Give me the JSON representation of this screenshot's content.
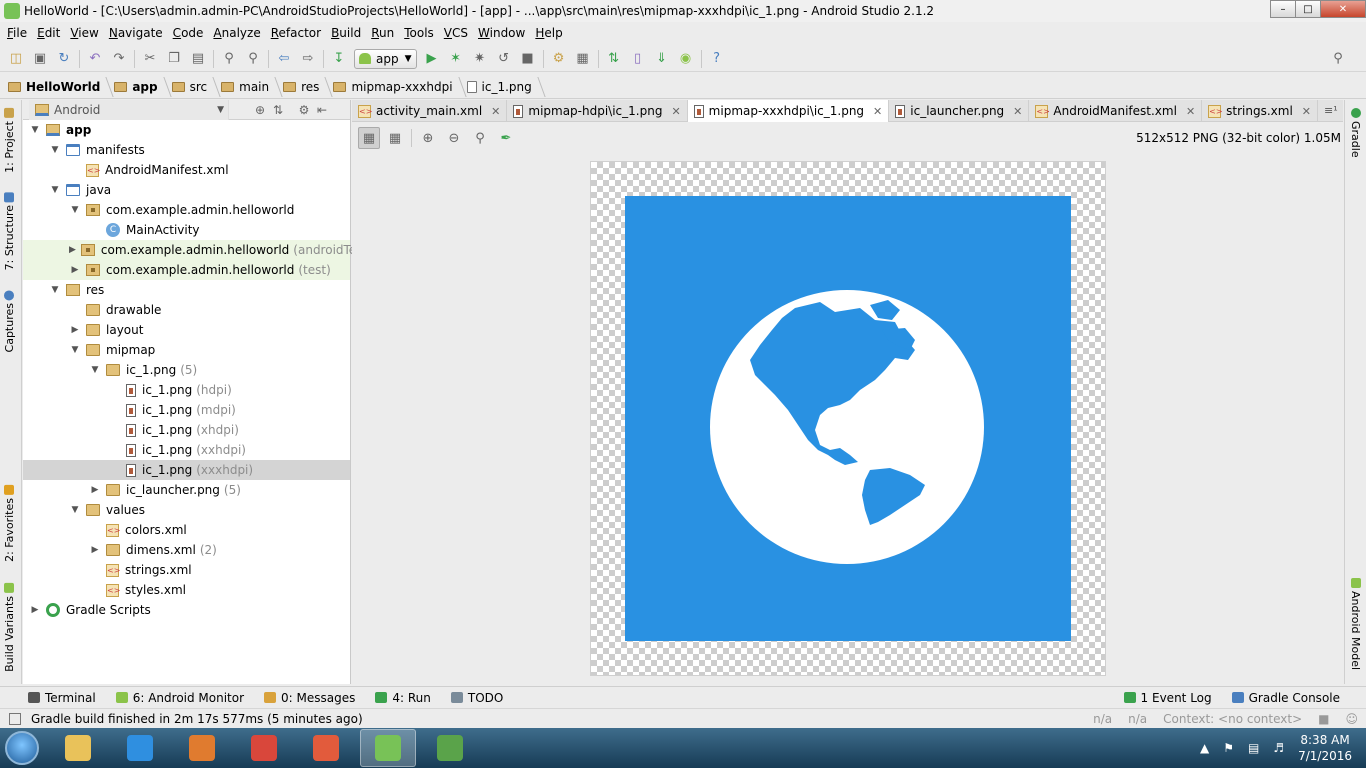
{
  "window": {
    "title": "HelloWorld - [C:\\Users\\admin.admin-PC\\AndroidStudioProjects\\HelloWorld] - [app] - ...\\app\\src\\main\\res\\mipmap-xxxhdpi\\ic_1.png - Android Studio 2.1.2",
    "minimize": "–",
    "maximize": "□",
    "close": "✕"
  },
  "menu": [
    "File",
    "Edit",
    "View",
    "Navigate",
    "Code",
    "Analyze",
    "Refactor",
    "Build",
    "Run",
    "Tools",
    "VCS",
    "Window",
    "Help"
  ],
  "toolbar": {
    "run_config": "app",
    "icons": [
      "open-icon",
      "save-icon",
      "sync-icon",
      "undo-icon",
      "redo-icon",
      "cut-icon",
      "copy-icon",
      "paste-icon",
      "find-icon",
      "replace-icon",
      "back-icon",
      "forward-icon",
      "make-icon",
      "run-icon",
      "debug-icon",
      "attach-icon",
      "apply-changes-icon",
      "stop-icon",
      "project-structure-icon",
      "sdk-manager-icon",
      "avd-manager-icon",
      "sync-gradle-icon",
      "device-monitor-icon",
      "android-icon",
      "help-icon"
    ],
    "search_icon": "search-icon"
  },
  "breadcrumb": [
    "HelloWorld",
    "app",
    "src",
    "main",
    "res",
    "mipmap-xxxhdpi",
    "ic_1.png"
  ],
  "left_strip": [
    "1: Project",
    "7: Structure",
    "Captures",
    "2: Favorites",
    "Build Variants"
  ],
  "right_strip": [
    "Gradle",
    "Android Model"
  ],
  "project": {
    "view": "Android",
    "tree": [
      {
        "label": "app",
        "extra": "",
        "indent": 0,
        "icon": "appf",
        "tw": "▼",
        "bold": true
      },
      {
        "label": "manifests",
        "extra": "",
        "indent": 1,
        "icon": "bfolder",
        "tw": "▼"
      },
      {
        "label": "AndroidManifest.xml",
        "extra": "",
        "indent": 2,
        "icon": "xml",
        "tw": ""
      },
      {
        "label": "java",
        "extra": "",
        "indent": 1,
        "icon": "bfolder",
        "tw": "▼"
      },
      {
        "label": "com.example.admin.helloworld",
        "extra": "",
        "indent": 2,
        "icon": "pkg",
        "tw": "▼"
      },
      {
        "label": "MainActivity",
        "extra": "",
        "indent": 3,
        "icon": "cls",
        "tw": ""
      },
      {
        "label": "com.example.admin.helloworld",
        "extra": "(androidTest)",
        "indent": 2,
        "icon": "pkg",
        "tw": "▶",
        "green": true
      },
      {
        "label": "com.example.admin.helloworld",
        "extra": "(test)",
        "indent": 2,
        "icon": "pkg",
        "tw": "▶",
        "green": true
      },
      {
        "label": "res",
        "extra": "",
        "indent": 1,
        "icon": "res",
        "tw": "▼"
      },
      {
        "label": "drawable",
        "extra": "",
        "indent": 2,
        "icon": "folder",
        "tw": ""
      },
      {
        "label": "layout",
        "extra": "",
        "indent": 2,
        "icon": "folder",
        "tw": "▶"
      },
      {
        "label": "mipmap",
        "extra": "",
        "indent": 2,
        "icon": "folder",
        "tw": "▼"
      },
      {
        "label": "ic_1.png",
        "extra": "(5)",
        "indent": 3,
        "icon": "folder",
        "tw": "▼"
      },
      {
        "label": "ic_1.png",
        "extra": "(hdpi)",
        "indent": 4,
        "icon": "img",
        "tw": ""
      },
      {
        "label": "ic_1.png",
        "extra": "(mdpi)",
        "indent": 4,
        "icon": "img",
        "tw": ""
      },
      {
        "label": "ic_1.png",
        "extra": "(xhdpi)",
        "indent": 4,
        "icon": "img",
        "tw": ""
      },
      {
        "label": "ic_1.png",
        "extra": "(xxhdpi)",
        "indent": 4,
        "icon": "img",
        "tw": ""
      },
      {
        "label": "ic_1.png",
        "extra": "(xxxhdpi)",
        "indent": 4,
        "icon": "img",
        "tw": "",
        "selected": true
      },
      {
        "label": "ic_launcher.png",
        "extra": "(5)",
        "indent": 3,
        "icon": "folder",
        "tw": "▶"
      },
      {
        "label": "values",
        "extra": "",
        "indent": 2,
        "icon": "folder",
        "tw": "▼"
      },
      {
        "label": "colors.xml",
        "extra": "",
        "indent": 3,
        "icon": "xml",
        "tw": ""
      },
      {
        "label": "dimens.xml",
        "extra": "(2)",
        "indent": 3,
        "icon": "folder",
        "tw": "▶"
      },
      {
        "label": "strings.xml",
        "extra": "",
        "indent": 3,
        "icon": "xml",
        "tw": ""
      },
      {
        "label": "styles.xml",
        "extra": "",
        "indent": 3,
        "icon": "xml",
        "tw": ""
      },
      {
        "label": "Gradle Scripts",
        "extra": "",
        "indent": 0,
        "icon": "grad",
        "tw": "▶"
      }
    ]
  },
  "tabs": [
    {
      "label": "activity_main.xml",
      "icon": "xml",
      "active": false
    },
    {
      "label": "mipmap-hdpi\\ic_1.png",
      "icon": "img",
      "active": false
    },
    {
      "label": "mipmap-xxxhdpi\\ic_1.png",
      "icon": "img",
      "active": true
    },
    {
      "label": "ic_launcher.png",
      "icon": "img",
      "active": false
    },
    {
      "label": "AndroidManifest.xml",
      "icon": "xml",
      "active": false
    },
    {
      "label": "strings.xml",
      "icon": "xml",
      "active": false
    }
  ],
  "tabs_more": "≡¹",
  "image": {
    "info": "512x512 PNG (32-bit color) 1.05M",
    "bg_color": "#2991e2",
    "icon": "globe-icon"
  },
  "bottom_tabs": [
    {
      "label": "Terminal",
      "color": "#555555"
    },
    {
      "label": "6: Android Monitor",
      "color": "#8bc34a"
    },
    {
      "label": "0: Messages",
      "color": "#d9a23b"
    },
    {
      "label": "4: Run",
      "color": "#3aa24d"
    },
    {
      "label": "TODO",
      "color": "#7a8b9a"
    }
  ],
  "bottom_tabs_right": [
    {
      "label": "1 Event Log",
      "color": "#3aa24d"
    },
    {
      "label": "Gradle Console",
      "color": "#4a7fbf"
    }
  ],
  "status": {
    "message": "Gradle build finished in 2m 17s 577ms (5 minutes ago)",
    "na1": "n/a",
    "na2": "n/a",
    "context": "Context: <no context>"
  },
  "taskbar": {
    "apps": [
      {
        "name": "explorer-app",
        "color": "#e9c25a"
      },
      {
        "name": "internet-explorer-app",
        "color": "#2f8fe0"
      },
      {
        "name": "media-player-app",
        "color": "#e07b2f"
      },
      {
        "name": "chrome-app",
        "color": "#d9473b"
      },
      {
        "name": "home-app",
        "color": "#e25b3c"
      },
      {
        "name": "android-studio-app",
        "color": "#78c257",
        "active": true
      },
      {
        "name": "android-sdk-app",
        "color": "#5aa34a"
      }
    ],
    "time": "8:38 AM",
    "date": "7/1/2016"
  }
}
